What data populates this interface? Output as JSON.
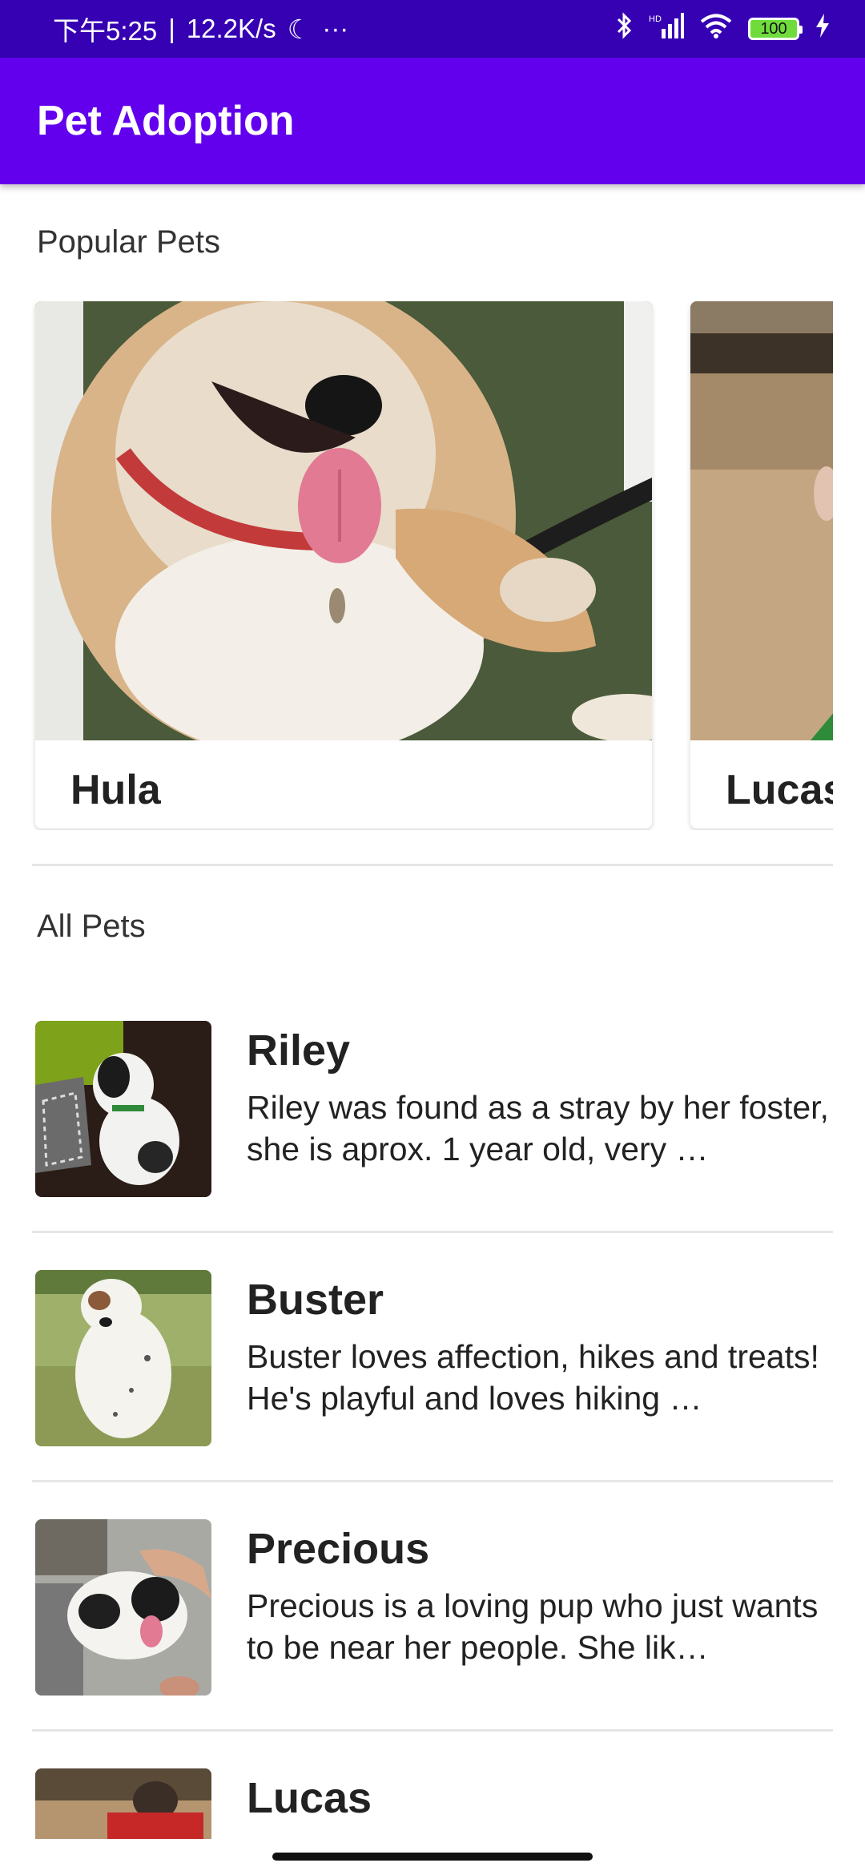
{
  "status_bar": {
    "time": "下午5:25",
    "speed": "12.2K/s",
    "battery": "100",
    "network": "HD"
  },
  "app_bar": {
    "title": "Pet Adoption"
  },
  "popular": {
    "title": "Popular Pets",
    "cards": [
      {
        "name": "Hula"
      },
      {
        "name": "Lucas"
      }
    ]
  },
  "all_pets": {
    "title": "All Pets",
    "items": [
      {
        "name": "Riley",
        "description": "Riley was found as a stray by her foster, she is aprox. 1 year old, very …"
      },
      {
        "name": "Buster",
        "description": "Buster loves affection, hikes and treats! He's playful and loves hiking …"
      },
      {
        "name": "Precious",
        "description": "Precious is a loving pup who just wants to be near her people. She lik…"
      },
      {
        "name": "Lucas",
        "description": ""
      }
    ]
  },
  "colors": {
    "status_bar": "#3600b3",
    "app_bar": "#6200ee"
  }
}
